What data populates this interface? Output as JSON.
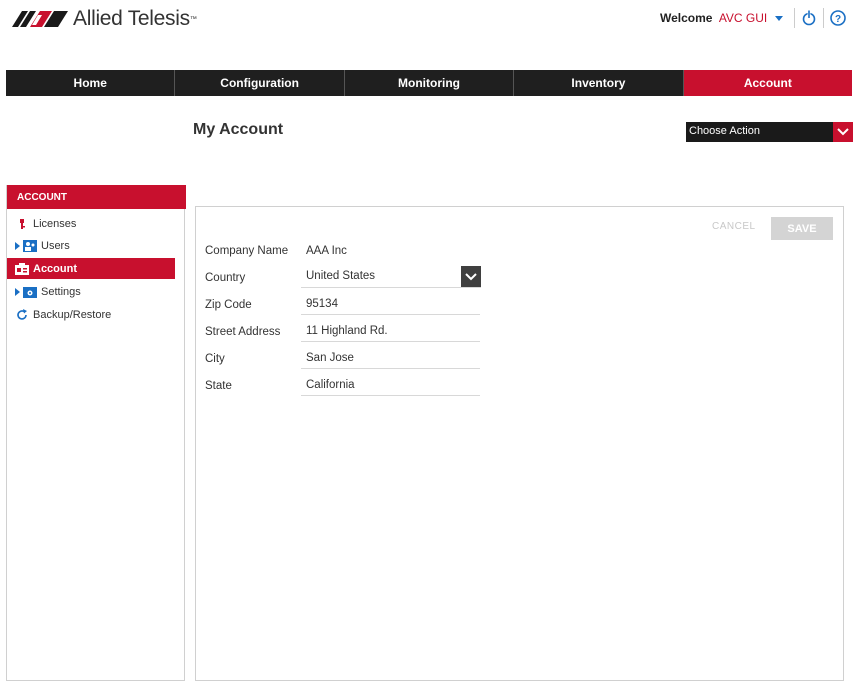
{
  "header": {
    "logo_text": "Allied Telesis",
    "logo_tm": "™",
    "welcome_label": "Welcome",
    "user_name": "AVC GUI"
  },
  "nav": {
    "tabs": [
      {
        "label": "Home",
        "active": false
      },
      {
        "label": "Configuration",
        "active": false
      },
      {
        "label": "Monitoring",
        "active": false
      },
      {
        "label": "Inventory",
        "active": false
      },
      {
        "label": "Account",
        "active": true
      }
    ]
  },
  "page": {
    "title": "My Account",
    "action_select": "Choose Action"
  },
  "sidebar": {
    "header": "ACCOUNT",
    "items": [
      {
        "label": "Licenses",
        "icon": "key-icon"
      },
      {
        "label": "Users",
        "icon": "users-icon"
      },
      {
        "label": "Account",
        "icon": "account-icon"
      },
      {
        "label": "Settings",
        "icon": "settings-folder-icon"
      },
      {
        "label": "Backup/Restore",
        "icon": "refresh-icon"
      }
    ]
  },
  "panel": {
    "cancel_label": "CANCEL",
    "save_label": "SAVE",
    "fields": {
      "company_name": {
        "label": "Company Name",
        "value": "AAA Inc"
      },
      "country": {
        "label": "Country",
        "value": "United States"
      },
      "zip": {
        "label": "Zip Code",
        "value": "95134"
      },
      "street": {
        "label": "Street Address",
        "value": "11 Highland Rd."
      },
      "city": {
        "label": "City",
        "value": "San Jose"
      },
      "state": {
        "label": "State",
        "value": "California"
      }
    }
  },
  "colors": {
    "brand_red": "#c8102e",
    "nav_dark": "#1f1f1f",
    "link_blue": "#1a6fc4"
  }
}
